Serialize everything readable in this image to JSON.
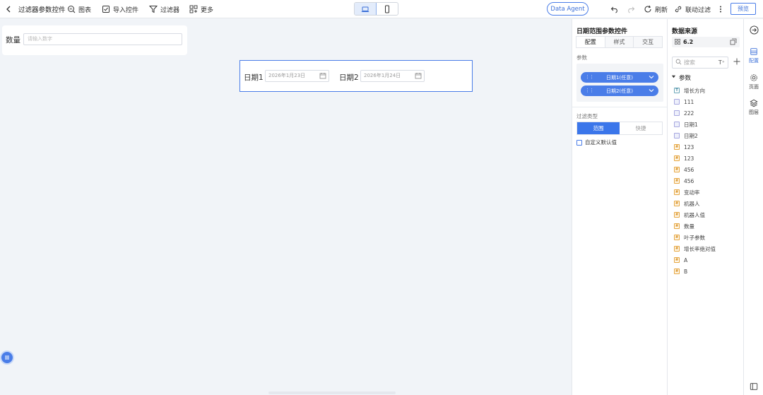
{
  "toolbar": {
    "title": "过滤器参数控件",
    "chart": "图表",
    "import_widget": "导入控件",
    "filter": "过滤器",
    "more": "更多",
    "data_agent": "Data Agent",
    "refresh": "刷新",
    "linked_filter": "联动过滤",
    "preview": "预览"
  },
  "canvas": {
    "qty_label": "数量",
    "qty_placeholder": "请输入数字",
    "date1_label": "日期1",
    "date1_value": "2026年1月23日",
    "date2_label": "日期2",
    "date2_value": "2026年1月24日"
  },
  "config_panel": {
    "title": "日期范围参数控件",
    "tabs": [
      "配置",
      "样式",
      "交互"
    ],
    "params_label": "参数",
    "params": [
      "日期1(任意)",
      "日期2(任意)"
    ],
    "filter_type_label": "过滤类型",
    "filter_types": [
      "范围",
      "快捷"
    ],
    "custom_default": "自定义默认值"
  },
  "data_source": {
    "title": "数据来源",
    "dataset": "6.2",
    "search_placeholder": "搜索",
    "group": "参数",
    "fields": [
      {
        "name": "增长方向",
        "type": "text"
      },
      {
        "name": "111",
        "type": "date"
      },
      {
        "name": "222",
        "type": "date"
      },
      {
        "name": "日期1",
        "type": "date"
      },
      {
        "name": "日期2",
        "type": "date"
      },
      {
        "name": "123",
        "type": "number"
      },
      {
        "name": "123",
        "type": "number"
      },
      {
        "name": "456",
        "type": "number"
      },
      {
        "name": "456",
        "type": "number"
      },
      {
        "name": "变动率",
        "type": "number"
      },
      {
        "name": "机器人",
        "type": "number"
      },
      {
        "name": "机器人值",
        "type": "number"
      },
      {
        "name": "数量",
        "type": "number"
      },
      {
        "name": "叶子参数",
        "type": "number"
      },
      {
        "name": "增长率绝对值",
        "type": "number"
      },
      {
        "name": "A",
        "type": "number"
      },
      {
        "name": "B",
        "type": "number"
      }
    ]
  },
  "rail": {
    "config": "配置",
    "page": "页面",
    "layers": "图层"
  },
  "colors": {
    "accent": "#4a7de8",
    "canvas_bg": "#f1f4f8"
  }
}
